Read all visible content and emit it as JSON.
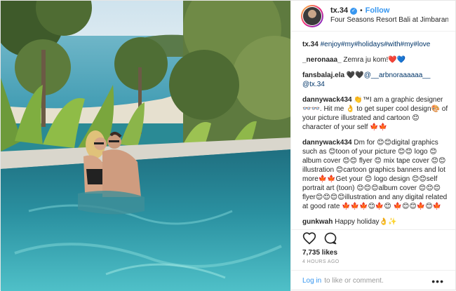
{
  "header": {
    "username": "tx.34",
    "verified_icon": "verified-badge-icon",
    "separator": "•",
    "follow_label": "Follow",
    "location": "Four Seasons Resort Bali at Jimbaran Bay"
  },
  "comments": [
    {
      "user": "tx.34",
      "text": "#enjoy#my#holidays#with#my#love"
    },
    {
      "user": "_neronaaa_",
      "text": "Zemra ju kom!❤️💙"
    },
    {
      "user": "fansbalaj.ela",
      "text": "🖤🖤@__arbnoraaaaaa__ @tx.34"
    },
    {
      "user": "dannywack434",
      "text": "👏™I am a graphic designer 👓👓. Hit me 👌 to get super cool design🎨 of your picture illustrated and cartoon 😊 character of your self 🍁🍁"
    },
    {
      "user": "dannywack434",
      "text": "Dm for 😊😊digital graphics such as 😊toon of your picture 😊😊 logo 😊album cover 😊😊 flyer 😊 mix tape cover 😊😊illustration 😊cartoon graphics banners and lot more🍁🍁Get your 😊 logo design 😊😊self portrait art (toon) 😊😊😊album cover 😊😊😊 flyer😊😊😊😊illustration and any digital related at good rate 🍁🍁🍁😊🍁😊 🍁😊😊🍁😊🍁"
    },
    {
      "user": "gunkwah",
      "text": "Happy holiday👌✨"
    }
  ],
  "actions": {
    "like_icon": "heart-icon",
    "comment_icon": "comment-bubble-icon"
  },
  "likes": "7,735 likes",
  "timestamp": "4 HOURS AGO",
  "footer": {
    "login_label": "Log in",
    "login_text": "to like or comment.",
    "more_label": "•••"
  },
  "colors": {
    "accent": "#3897f0",
    "tag": "#003569",
    "pool": "#2a8a95"
  }
}
